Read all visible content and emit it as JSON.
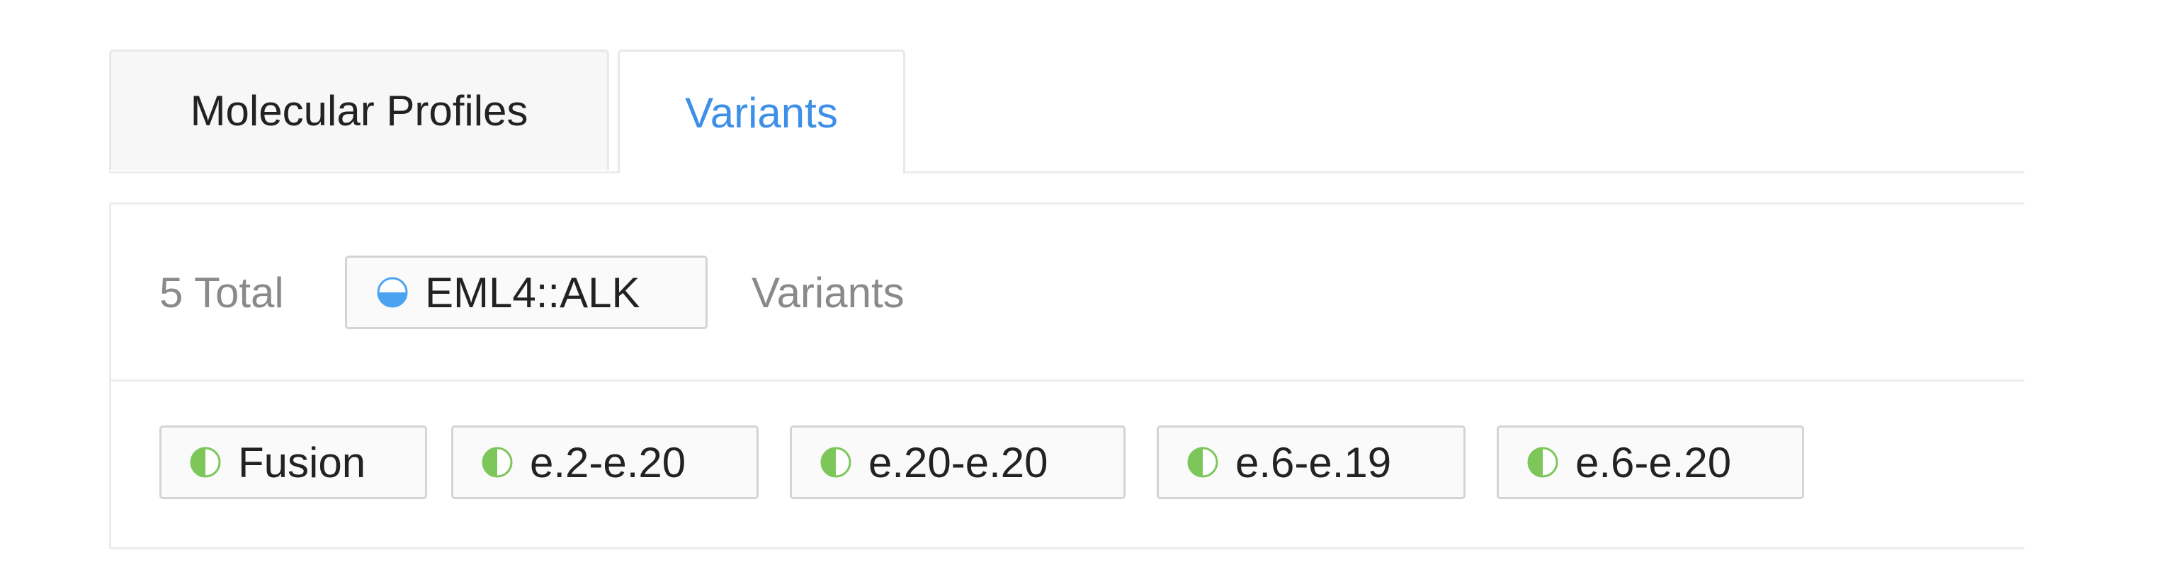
{
  "tabs": [
    {
      "label": "Molecular Profiles",
      "active": false
    },
    {
      "label": "Variants",
      "active": true
    }
  ],
  "summary": {
    "total_label": "5 Total",
    "gene": {
      "label": "EML4::ALK",
      "icon": "half-filled-circle-blue-icon"
    },
    "suffix_label": "Variants"
  },
  "variants": [
    {
      "label": "Fusion",
      "icon": "half-filled-circle-green-icon"
    },
    {
      "label": "e.2-e.20",
      "icon": "half-filled-circle-green-icon"
    },
    {
      "label": "e.20-e.20",
      "icon": "half-filled-circle-green-icon"
    },
    {
      "label": "e.6-e.19",
      "icon": "half-filled-circle-green-icon"
    },
    {
      "label": "e.6-e.20",
      "icon": "half-filled-circle-green-icon"
    }
  ],
  "colors": {
    "accent_blue": "#3d8fe8",
    "gene_icon_blue": "#4aa3f0",
    "variant_icon_green": "#7cc65a",
    "muted_text": "#8a8a8a"
  }
}
